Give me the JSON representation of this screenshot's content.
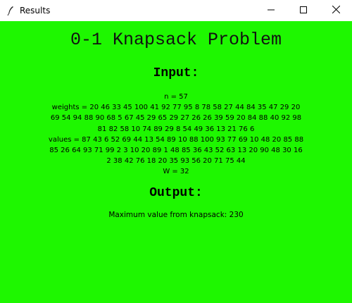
{
  "window": {
    "title": "Results",
    "icon": "feather-icon",
    "controls": [
      "minimize-icon",
      "maximize-icon",
      "close-icon"
    ],
    "background": "#1ef700"
  },
  "main": {
    "heading": "0-1 Knapsack Problem",
    "input_title": "Input:",
    "input_lines": [
      "n = 57",
      "weights = 20 46 33 45 100 41 92 77 95 8 78 58 27 44 84 35 47 29 20",
      "69 54 94 88 90 68 5 67 45 29 65 29 27 26 26 39 59 20 84 88 40 92 98",
      "81 82 58 10 74 89 29 8 54 49 36 13 21 76 6",
      "values = 87 43 6 52 69 44 13 54 89 10 88 100 93 77 69 10 48 20 85 88",
      "85 26 64 93 71 99 2 3 10 20 89 1 48 85 36 43 52 63 13 20 90 48 30 16",
      "2 38 42 76 18 20 35 93 56 20 71 75 44",
      "W = 32"
    ],
    "output_title": "Output:",
    "output_text": "Maximum value from knapsack: 230"
  }
}
